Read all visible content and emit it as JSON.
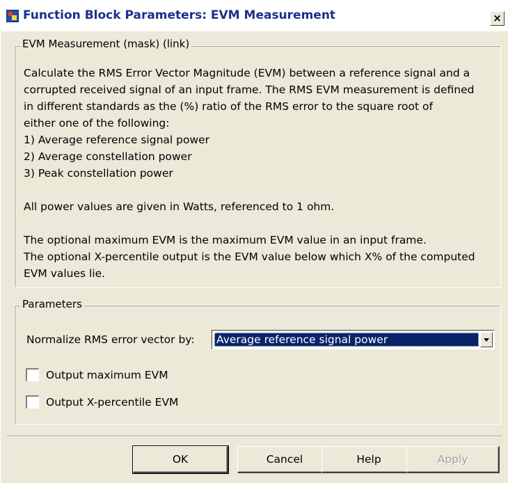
{
  "window": {
    "title": "Function Block Parameters: EVM Measurement",
    "close_label": "×"
  },
  "description_group": {
    "legend": "EVM Measurement (mask) (link)",
    "lines": [
      "Calculate the RMS Error Vector Magnitude (EVM) between a reference signal and a",
      "corrupted received signal of an input frame. The RMS EVM measurement is defined",
      "in different standards as the (%) ratio of the RMS error to the square root of",
      "either one of the following:",
      "1) Average reference signal power",
      "2) Average constellation power",
      "3) Peak constellation power",
      "",
      "All power values are given in Watts, referenced to 1 ohm.",
      "",
      "The optional maximum EVM is the maximum EVM value in an input frame.",
      "The optional X-percentile output is the EVM value below which X% of the computed",
      "EVM values lie."
    ]
  },
  "parameters_group": {
    "legend": "Parameters",
    "normalize_label": "Normalize RMS error vector by:",
    "normalize_value": "Average reference signal power",
    "output_max_evm": {
      "label": "Output maximum EVM",
      "checked": false
    },
    "output_xpercentile_evm": {
      "label": "Output X-percentile EVM",
      "checked": false
    }
  },
  "buttons": {
    "ok": "OK",
    "cancel": "Cancel",
    "help": "Help",
    "apply": "Apply"
  }
}
